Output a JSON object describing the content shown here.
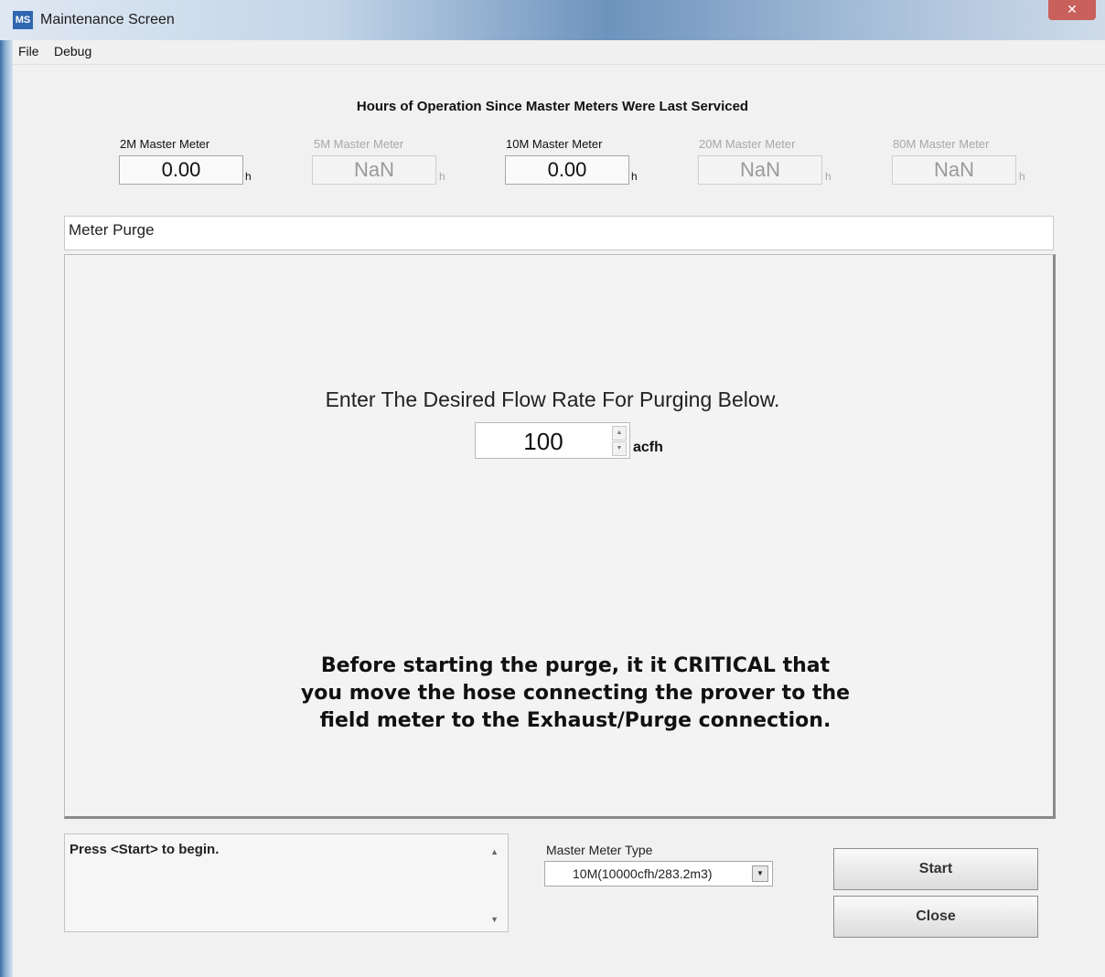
{
  "window": {
    "title": "Maintenance Screen",
    "icon_text": "MS",
    "close_glyph": "✕"
  },
  "menu": {
    "items": [
      "File",
      "Debug"
    ]
  },
  "hours": {
    "heading": "Hours of Operation Since Master Meters Were Last Serviced",
    "unit": "h",
    "meters": [
      {
        "label": "2M Master Meter",
        "value": "0.00",
        "enabled": true
      },
      {
        "label": "5M Master Meter",
        "value": "NaN",
        "enabled": false
      },
      {
        "label": "10M Master Meter",
        "value": "0.00",
        "enabled": true
      },
      {
        "label": "20M Master Meter",
        "value": "NaN",
        "enabled": false
      },
      {
        "label": "80M Master Meter",
        "value": "NaN",
        "enabled": false
      }
    ]
  },
  "purge": {
    "title": "Meter Purge",
    "prompt": "Enter The Desired Flow Rate For Purging Below.",
    "flow_value": "100",
    "flow_unit": "acfh",
    "spin_up_glyph": "▲",
    "spin_down_glyph": "▼",
    "warning_lines": [
      "Before starting the purge, it it CRITICAL that",
      "you move the hose connecting the prover to the",
      "field meter to the Exhaust/Purge connection."
    ]
  },
  "status": {
    "text": "Press <Start> to begin.",
    "scroll_up_glyph": "▲",
    "scroll_down_glyph": "▼"
  },
  "master_meter_type": {
    "label": "Master Meter Type",
    "selected": "10M(10000cfh/283.2m3)",
    "dropdown_glyph": "▼"
  },
  "buttons": {
    "start": "Start",
    "close": "Close"
  }
}
